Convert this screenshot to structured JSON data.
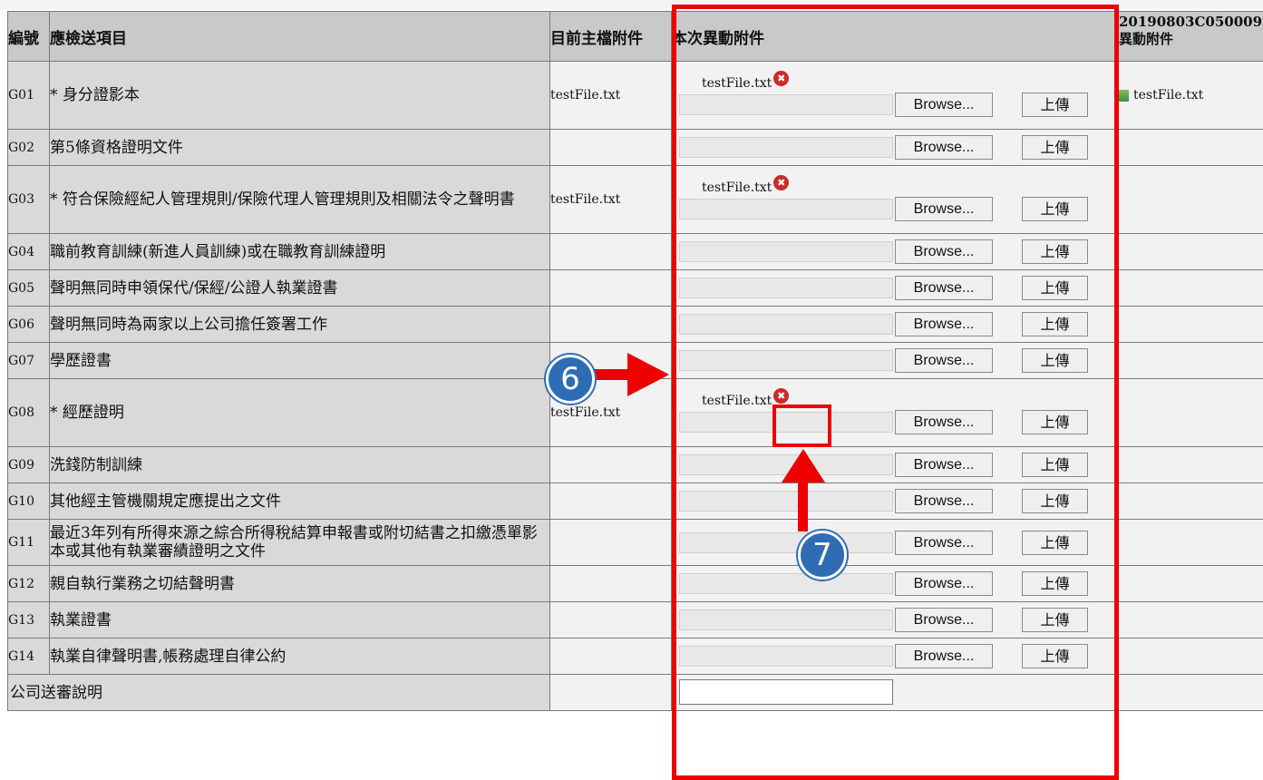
{
  "table": {
    "headers": {
      "code": "編號",
      "item": "應檢送項目",
      "main": "目前主檔附件",
      "current": "本次異動附件",
      "extra_line1": "20190803C050009",
      "extra_line2": "異動附件"
    },
    "browse_label": "Browse...",
    "upload_label": "上傳",
    "remove_icon_glyph": "✖",
    "rows": [
      {
        "code": "G01",
        "name": "* 身分證影本",
        "main": "testFile.txt",
        "current": "testFile.txt",
        "extra": "testFile.txt"
      },
      {
        "code": "G02",
        "name": "第5條資格證明文件",
        "main": "",
        "current": "",
        "extra": ""
      },
      {
        "code": "G03",
        "name": "* 符合保險經紀人管理規則/保險代理人管理規則及相關法令之聲明書",
        "main": "testFile.txt",
        "current": "testFile.txt",
        "extra": ""
      },
      {
        "code": "G04",
        "name": "職前教育訓練(新進人員訓練)或在職教育訓練證明",
        "main": "",
        "current": "",
        "extra": ""
      },
      {
        "code": "G05",
        "name": "聲明無同時申領保代/保經/公證人執業證書",
        "main": "",
        "current": "",
        "extra": ""
      },
      {
        "code": "G06",
        "name": "聲明無同時為兩家以上公司擔任簽署工作",
        "main": "",
        "current": "",
        "extra": ""
      },
      {
        "code": "G07",
        "name": "學歷證書",
        "main": "",
        "current": "",
        "extra": ""
      },
      {
        "code": "G08",
        "name": "* 經歷證明",
        "main": "testFile.txt",
        "current": "testFile.txt",
        "extra": ""
      },
      {
        "code": "G09",
        "name": "洗錢防制訓練",
        "main": "",
        "current": "",
        "extra": ""
      },
      {
        "code": "G10",
        "name": "其他經主管機關規定應提出之文件",
        "main": "",
        "current": "",
        "extra": ""
      },
      {
        "code": "G11",
        "name": "最近3年列有所得來源之綜合所得稅結算申報書或附切結書之扣繳憑單影本或其他有執業審績證明之文件",
        "main": "",
        "current": "",
        "extra": ""
      },
      {
        "code": "G12",
        "name": "親自執行業務之切結聲明書",
        "main": "",
        "current": "",
        "extra": ""
      },
      {
        "code": "G13",
        "name": "執業證書",
        "main": "",
        "current": "",
        "extra": ""
      },
      {
        "code": "G14",
        "name": "執業自律聲明書,帳務處理自律公約",
        "main": "",
        "current": "",
        "extra": ""
      }
    ],
    "footer": {
      "label": "公司送審說明"
    }
  },
  "annotations": {
    "step_6": "6",
    "step_7": "7",
    "highlight_color": "#ee0000",
    "badge_color": "#2e6db4"
  }
}
